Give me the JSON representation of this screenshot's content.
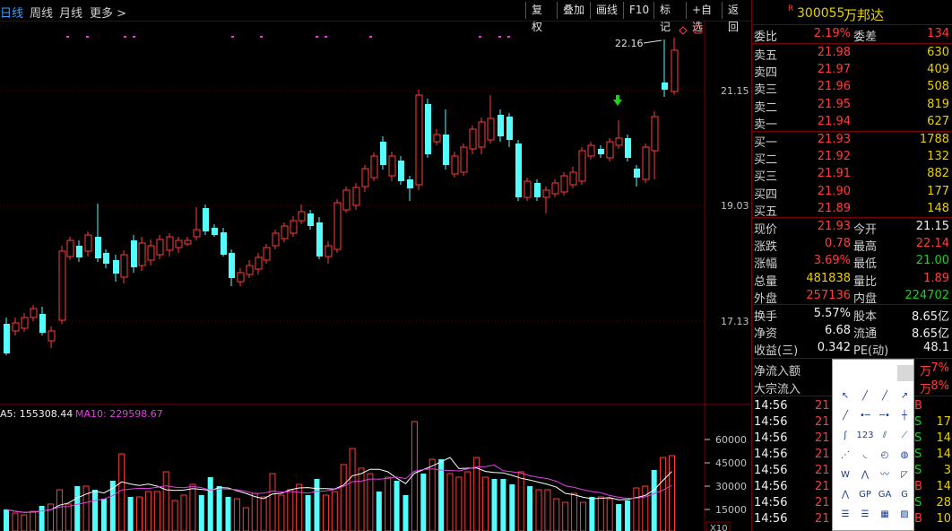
{
  "toolbar": {
    "periods": [
      "日线",
      "周线",
      "月线",
      "更多 >"
    ],
    "buttons": [
      "复权",
      "叠加",
      "画线",
      "F10",
      "标记",
      "+自选",
      "返回"
    ]
  },
  "kchart": {
    "axis_labels": [
      "21.15",
      "19.03",
      "17.13"
    ],
    "high_label": "22.16"
  },
  "volume": {
    "ma5_label": "A5: 155308.44",
    "ma10_label": "MA10: 229598.67",
    "axis_labels": [
      "60000",
      "45000",
      "30000",
      "15000"
    ],
    "unit": "X10"
  },
  "stock": {
    "marker": "R",
    "code": "300055",
    "name": "万邦达"
  },
  "quote": {
    "weibi_label": "委比",
    "weibi": "2.19%",
    "weicha_label": "委差",
    "weicha": "134",
    "asks": [
      {
        "label": "卖五",
        "price": "21.98",
        "vol": "630"
      },
      {
        "label": "卖四",
        "price": "21.97",
        "vol": "409"
      },
      {
        "label": "卖三",
        "price": "21.96",
        "vol": "508"
      },
      {
        "label": "卖二",
        "price": "21.95",
        "vol": "819"
      },
      {
        "label": "卖一",
        "price": "21.94",
        "vol": "627"
      }
    ],
    "bids": [
      {
        "label": "买一",
        "price": "21.93",
        "vol": "1788"
      },
      {
        "label": "买二",
        "price": "21.92",
        "vol": "132"
      },
      {
        "label": "买三",
        "price": "21.91",
        "vol": "882"
      },
      {
        "label": "买四",
        "price": "21.90",
        "vol": "177"
      },
      {
        "label": "买五",
        "price": "21.89",
        "vol": "148"
      }
    ],
    "stats": [
      {
        "l1": "现价",
        "v1": "21.93",
        "c1": "red",
        "l2": "今开",
        "v2": "21.15",
        "c2": "white"
      },
      {
        "l1": "涨跌",
        "v1": "0.78",
        "c1": "red",
        "l2": "最高",
        "v2": "22.14",
        "c2": "red"
      },
      {
        "l1": "涨幅",
        "v1": "3.69%",
        "c1": "red",
        "l2": "最低",
        "v2": "21.00",
        "c2": "green"
      },
      {
        "l1": "总量",
        "v1": "481838",
        "c1": "yel",
        "l2": "量比",
        "v2": "1.89",
        "c2": "red"
      },
      {
        "l1": "外盘",
        "v1": "257136",
        "c1": "red",
        "l2": "内盘",
        "v2": "224702",
        "c2": "green"
      }
    ],
    "fundamentals": [
      {
        "l1": "换手",
        "v1": "5.57%",
        "l2": "股本",
        "v2": "8.65亿"
      },
      {
        "l1": "净资",
        "v1": "6.68",
        "l2": "流通",
        "v2": "8.65亿"
      },
      {
        "l1": "收益(三)",
        "v1": "0.342",
        "l2": "PE(动)",
        "v2": "48.1"
      }
    ],
    "flows": [
      {
        "label": "净流入额",
        "pct": "7%",
        "suffix": "万"
      },
      {
        "label": "大宗流入",
        "pct": "8%",
        "suffix": "万"
      }
    ],
    "ticks": [
      {
        "time": "14:56",
        "price": "21",
        "flag": "B",
        "vol": ""
      },
      {
        "time": "14:56",
        "price": "21",
        "flag": "S",
        "vol": "17"
      },
      {
        "time": "14:56",
        "price": "21",
        "flag": "S",
        "vol": "14"
      },
      {
        "time": "14:56",
        "price": "21",
        "flag": "S",
        "vol": "14"
      },
      {
        "time": "14:56",
        "price": "21",
        "flag": "S",
        "vol": "3"
      },
      {
        "time": "14:56",
        "price": "21",
        "flag": "B",
        "vol": "14"
      },
      {
        "time": "14:56",
        "price": "21",
        "flag": "S",
        "vol": "28"
      },
      {
        "time": "14:56",
        "price": "21",
        "flag": "B",
        "vol": "10"
      }
    ]
  },
  "palette_tools": [
    "cursor-icon",
    "line-icon",
    "ray-icon",
    "arrow-line-icon",
    "segment-icon",
    "horizontal-line-icon",
    "price-line-icon",
    "vertical-line-icon",
    "parallel-icon",
    "wave-count-icon",
    "channel-icon",
    "fan-icon",
    "fibonacci-icon",
    "arc-icon",
    "circle-icon",
    "cycle-icon",
    "w-pattern-icon",
    "zigzag-icon",
    "trend-icon",
    "triangle-icon",
    "m-pattern-icon",
    "gp-icon",
    "ga-icon",
    "gann-icon",
    "text-icon",
    "box-text-icon",
    "grid-icon",
    "hatch-icon"
  ],
  "colors": {
    "up": "#ff3c3c",
    "down": "#54fcfc",
    "ma5": "#ffffff",
    "ma10": "#e040e0",
    "grid": "#5a0000"
  }
}
